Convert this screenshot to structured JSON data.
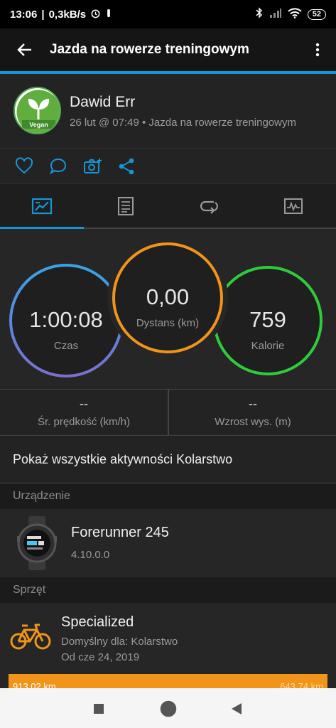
{
  "status_bar": {
    "time": "13:06",
    "network_speed": "0,3kB/s",
    "battery": "52"
  },
  "app_bar": {
    "title": "Jazda na rowerze treningowym"
  },
  "activity_header": {
    "user_name": "Dawid Err",
    "avatar_badge": "Vegan",
    "subtitle": "26 lut @ 07:49 • Jazda na rowerze treningowym"
  },
  "tabs": [
    "stats-tab",
    "details-tab",
    "laps-tab",
    "chart-tab"
  ],
  "main_stats": {
    "time": {
      "value": "1:00:08",
      "label": "Czas"
    },
    "distance": {
      "value": "0,00",
      "label": "Dystans (km)"
    },
    "calories": {
      "value": "759",
      "label": "Kalorie"
    }
  },
  "secondary_stats": {
    "avg_speed": {
      "value": "--",
      "label": "Śr. prędkość (km/h)"
    },
    "elevation_gain": {
      "value": "--",
      "label": "Wzrost wys. (m)"
    }
  },
  "show_all_link": "Pokaż wszystkie aktywności Kolarstwo",
  "device_section": {
    "header": "Urządzenie",
    "name": "Forerunner 245",
    "version": "4.10.0.0"
  },
  "gear_section": {
    "header": "Sprzęt",
    "name": "Specialized",
    "default_for": "Domyślny dla: Kolarstwo",
    "since": "Od cze 24, 2019",
    "distance_used": "913,02 km",
    "distance_total": "643,74 km"
  },
  "colors": {
    "accent": "#1795d4",
    "ring_time": "#6f7fd8",
    "ring_distance": "#f0941a",
    "ring_calories": "#2fcc3a",
    "gear_bar": "#f0941a"
  }
}
